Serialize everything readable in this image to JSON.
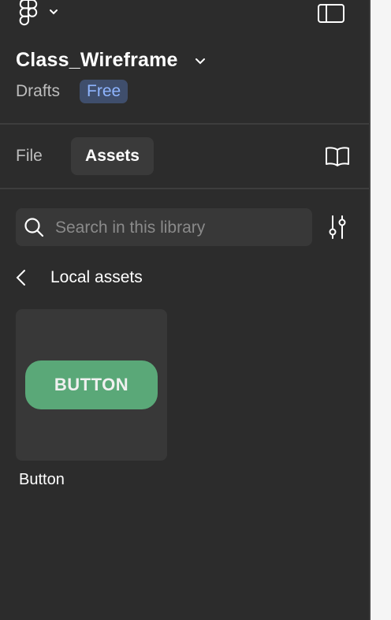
{
  "header": {
    "file_title": "Class_Wireframe",
    "location": "Drafts",
    "plan_badge": "Free"
  },
  "tabs": [
    {
      "label": "File",
      "active": false
    },
    {
      "label": "Assets",
      "active": true
    }
  ],
  "search": {
    "placeholder": "Search in this library"
  },
  "section": {
    "title": "Local assets"
  },
  "assets": [
    {
      "name": "Button",
      "preview_text": "BUTTON"
    }
  ],
  "colors": {
    "panel_bg": "#2c2c2c",
    "badge_bg": "#3f4e6c",
    "badge_text": "#8fb5ff",
    "button_preview": "#5aa878"
  },
  "icons": [
    "figma-logo-icon",
    "chevron-down-icon",
    "sidebar-toggle-icon",
    "book-icon",
    "search-icon",
    "filter-icon",
    "back-chevron-icon"
  ]
}
